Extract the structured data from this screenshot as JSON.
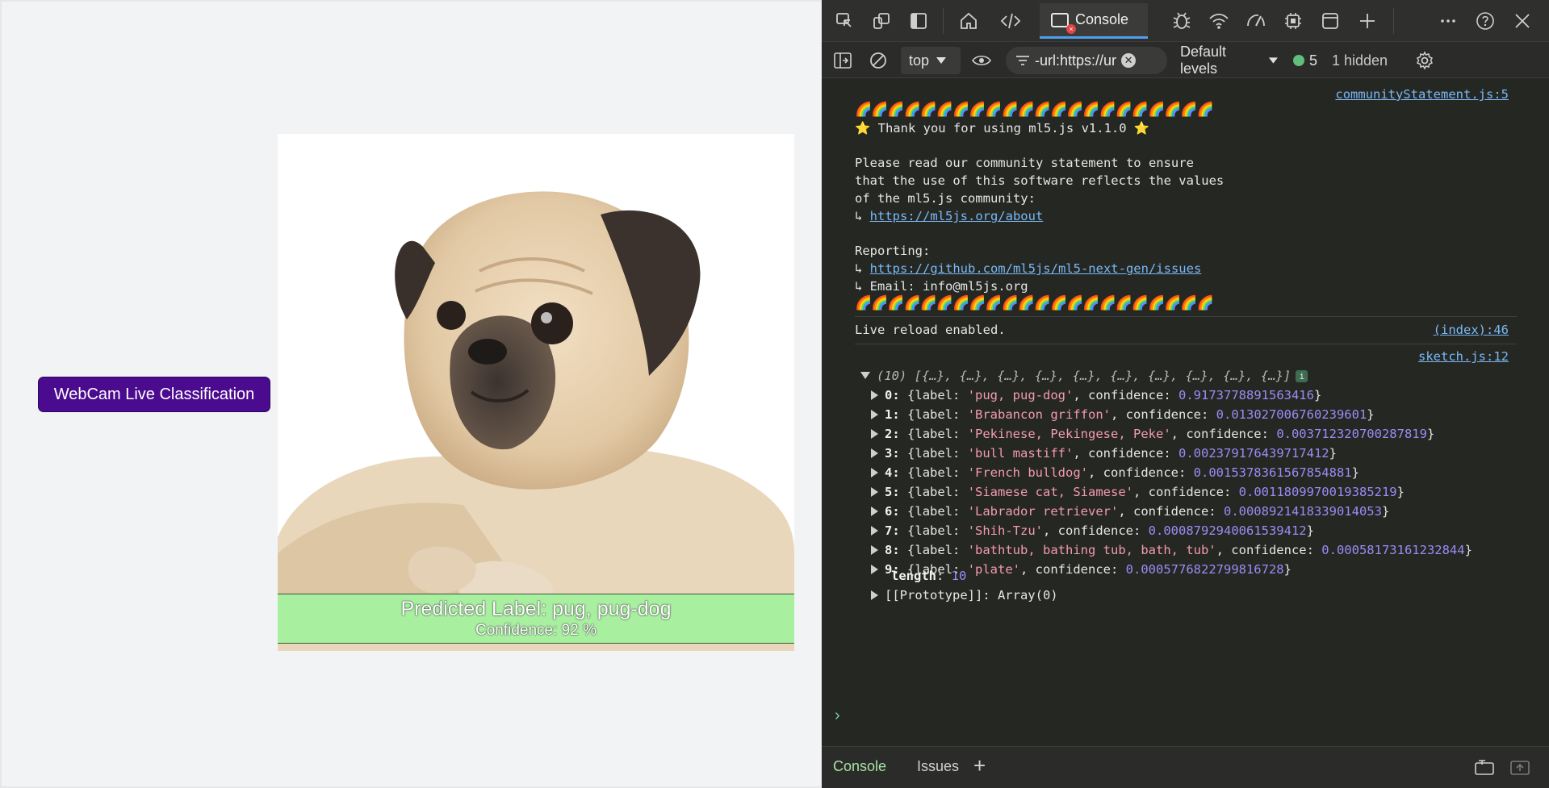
{
  "page": {
    "button_label": "WebCam Live Classification",
    "prediction_label": "Predicted Label: pug, pug-dog",
    "prediction_confidence": "Confidence: 92 %"
  },
  "devtools": {
    "active_tab": "Console",
    "toolbar": {
      "context": "top",
      "filter_text": "-url:https://ur",
      "levels": "Default levels",
      "message_count": "5",
      "hidden_count": "1 hidden"
    },
    "console": {
      "community_source": "communityStatement.js:5",
      "rainbow_row": "🌈🌈🌈🌈🌈🌈🌈🌈🌈🌈🌈🌈🌈🌈🌈🌈🌈🌈🌈🌈🌈🌈",
      "thanks_line": "⭐ Thank you for using ml5.js v1.1.0 ⭐",
      "statement_lines": [
        "Please read our community statement to ensure",
        "that the use of this software reflects the values",
        "of the ml5.js community:"
      ],
      "about_prefix": "↳ ",
      "about_link": "https://ml5js.org/about",
      "reporting_label": "Reporting:",
      "issues_prefix": "↳ ",
      "issues_link": "https://github.com/ml5js/ml5-next-gen/issues",
      "email_line": "↳ Email: info@ml5js.org",
      "live_reload": "Live reload enabled.",
      "live_reload_source": "(index):46",
      "sketch_source": "sketch.js:12",
      "array_summary": "(10) [{…}, {…}, {…}, {…}, {…}, {…}, {…}, {…}, {…}, {…}]",
      "results": [
        {
          "idx": "0",
          "label": "'pug, pug-dog'",
          "confidence": "0.9173778891563416"
        },
        {
          "idx": "1",
          "label": "'Brabancon griffon'",
          "confidence": "0.013027006760239601"
        },
        {
          "idx": "2",
          "label": "'Pekinese, Pekingese, Peke'",
          "confidence": "0.003712320700287819"
        },
        {
          "idx": "3",
          "label": "'bull mastiff'",
          "confidence": "0.002379176439717412"
        },
        {
          "idx": "4",
          "label": "'French bulldog'",
          "confidence": "0.0015378361567854881"
        },
        {
          "idx": "5",
          "label": "'Siamese cat, Siamese'",
          "confidence": "0.0011809970019385219"
        },
        {
          "idx": "6",
          "label": "'Labrador retriever'",
          "confidence": "0.0008921418339014053"
        },
        {
          "idx": "7",
          "label": "'Shih-Tzu'",
          "confidence": "0.0008792940061539412"
        },
        {
          "idx": "8",
          "label": "'bathtub, bathing tub, bath, tub'",
          "confidence": "0.00058173161232844"
        },
        {
          "idx": "9",
          "label": "'plate'",
          "confidence": "0.0005776822799816728"
        }
      ],
      "length_key": "length",
      "length_value": "10",
      "prototype_line": "[[Prototype]]: Array(0)"
    },
    "drawer": {
      "console_tab": "Console",
      "issues_tab": "Issues"
    }
  },
  "colors": {
    "button_bg": "#4b0b8f",
    "banner_bg": "#a8f0a0",
    "devtools_bg": "#252723",
    "link": "#7ab8f5",
    "string": "#f49bb0",
    "number": "#9a8cf5"
  }
}
